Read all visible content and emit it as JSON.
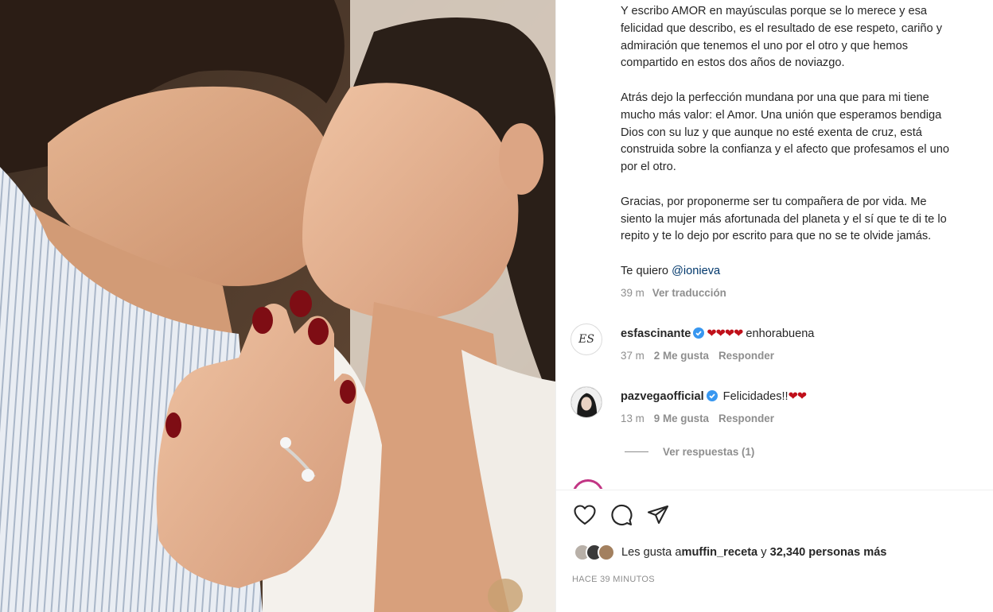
{
  "post": {
    "caption": {
      "p1": [
        "Y escribo AMOR en mayúsculas porque se lo merece y esa",
        "felicidad que describo, es el resultado de ese respeto, cariño y",
        "admiración que tenemos el uno por el otro y que hemos",
        "compartido en estos dos años de noviazgo."
      ],
      "p2": [
        "Atrás dejo la perfección mundana por una que para mi tiene",
        "mucho más valor: el Amor. Una unión que esperamos bendiga",
        "Dios con su luz y que aunque no esté exenta de cruz, está",
        "construida sobre la confianza y el afecto que profesamos el uno",
        "por el otro."
      ],
      "p3": [
        "Gracias, por proponerme ser tu compañera de por vida. Me",
        "siento la mujer más afortunada del planeta y el sí que te di te lo",
        "repito y te lo dejo por escrito para que no se te olvide jamás."
      ],
      "p4_prefix": "Te quiero ",
      "p4_mention": "@ionieva"
    },
    "caption_time": "39 m",
    "translate_label": "Ver traducción"
  },
  "comments": [
    {
      "avatar_text": "ES",
      "username": "esfascinante",
      "hearts": "❤❤❤❤",
      "text": " enhorabuena",
      "time": "37 m",
      "likes": "2 Me gusta",
      "reply": "Responder"
    },
    {
      "username": "pazvegaofficial",
      "text": " Felicidades!!",
      "hearts": "❤❤",
      "time": "13 m",
      "likes": "9 Me gusta",
      "reply": "Responder"
    }
  ],
  "view_replies": "Ver respuestas (1)",
  "likes": {
    "prefix": "Les gusta a ",
    "user": "muffin_receta",
    "middle": " y ",
    "count": "32,340 personas más"
  },
  "timestamp": "HACE 39 MINUTOS",
  "icons": {
    "like": "heart-icon",
    "comment": "comment-icon",
    "share": "share-icon",
    "verified": "verified-badge-icon"
  },
  "colors": {
    "mention": "#00376b",
    "verified": "#3897f0",
    "heart": "#c0101a",
    "muted": "#8e8e8e"
  }
}
